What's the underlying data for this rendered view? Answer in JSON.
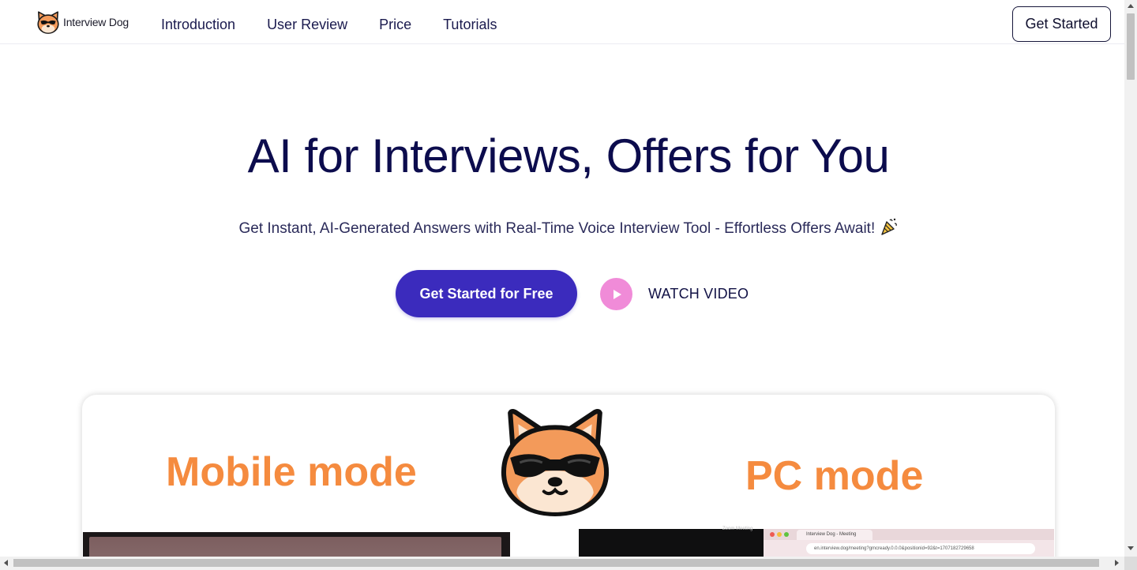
{
  "header": {
    "logo_text": "Interview Dog",
    "logo_icon": "shiba-dog-sunglasses-icon",
    "nav": [
      {
        "label": "Introduction"
      },
      {
        "label": "User Review"
      },
      {
        "label": "Price"
      },
      {
        "label": "Tutorials"
      }
    ],
    "cta_label": "Get Started"
  },
  "hero": {
    "title": "AI for Interviews, Offers for You",
    "subtitle": "Get Instant, AI-Generated Answers with Real-Time Voice Interview Tool - Effortless Offers Await!",
    "subtitle_icon": "party-popper-icon",
    "primary_cta": "Get Started for Free",
    "watch_label": "WATCH VIDEO"
  },
  "showcase": {
    "mobile_title": "Mobile mode",
    "pc_title": "PC mode",
    "pc_screenshot": {
      "tab_title": "Interview Dog - Meeting",
      "url": "en.interview.dog/meeting?gmcready.0.0.0&positionid=92&t=1707182729658",
      "caption": "Zoom Meeting"
    }
  },
  "colors": {
    "brand_primary": "#3b2bbd",
    "accent_orange": "#f58b3f",
    "play_pink": "#f08bd8",
    "text_dark": "#0c0c4d"
  }
}
